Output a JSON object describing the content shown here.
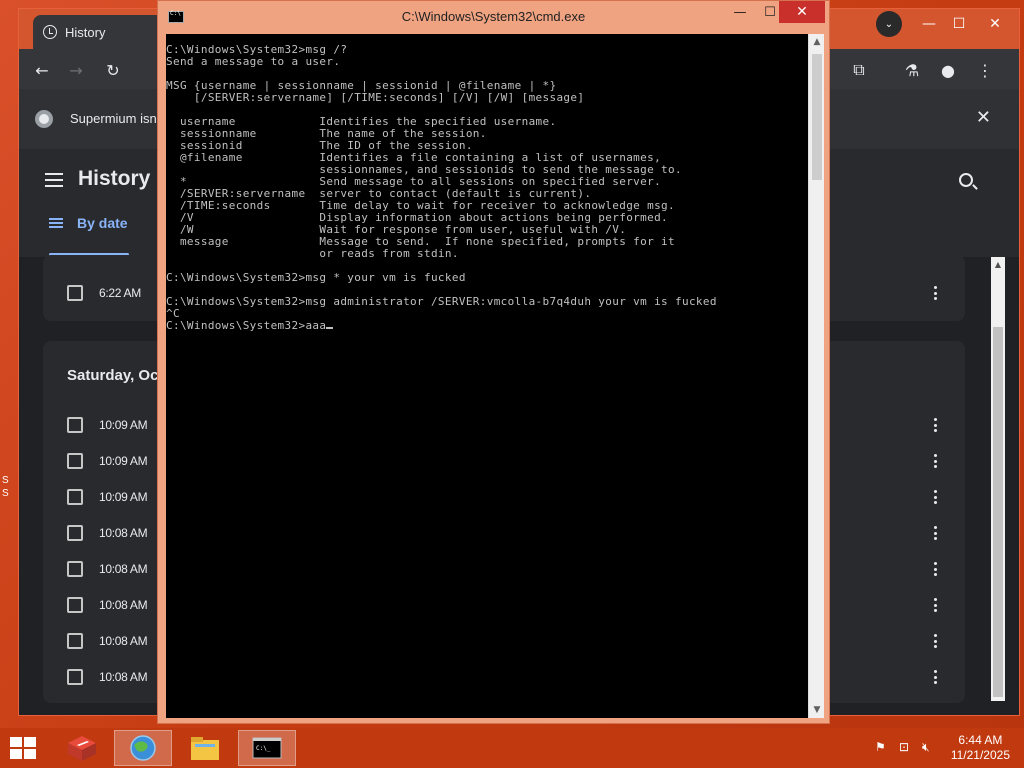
{
  "desktop": {
    "edge_text": "S\nS"
  },
  "browser": {
    "tab_title": "History",
    "info_bar_text": "Supermium isn",
    "history_title": "History",
    "by_date_label": "By date",
    "top_card_time": "6:22 AM",
    "date_heading": "Saturday, Oc",
    "entries": [
      "10:09 AM",
      "10:09 AM",
      "10:09 AM",
      "10:08 AM",
      "10:08 AM",
      "10:08 AM",
      "10:08 AM",
      "10:08 AM"
    ]
  },
  "cmd": {
    "title": "C:\\Windows\\System32\\cmd.exe",
    "lines": [
      "C:\\Windows\\System32>msg /?",
      "Send a message to a user.",
      "",
      "MSG {username | sessionname | sessionid | @filename | *}",
      "    [/SERVER:servername] [/TIME:seconds] [/V] [/W] [message]",
      "",
      "  username            Identifies the specified username.",
      "  sessionname         The name of the session.",
      "  sessionid           The ID of the session.",
      "  @filename           Identifies a file containing a list of usernames,",
      "                      sessionnames, and sessionids to send the message to.",
      "  *                   Send message to all sessions on specified server.",
      "  /SERVER:servername  server to contact (default is current).",
      "  /TIME:seconds       Time delay to wait for receiver to acknowledge msg.",
      "  /V                  Display information about actions being performed.",
      "  /W                  Wait for response from user, useful with /V.",
      "  message             Message to send.  If none specified, prompts for it",
      "                      or reads from stdin.",
      "",
      "C:\\Windows\\System32>msg * your vm is fucked",
      "",
      "C:\\Windows\\System32>msg administrator /SERVER:vmcolla-b7q4duh your vm is fucked",
      "^C",
      "C:\\Windows\\System32>aaa"
    ]
  },
  "taskbar": {
    "time": "6:44 AM",
    "date": "11/21/2025"
  }
}
